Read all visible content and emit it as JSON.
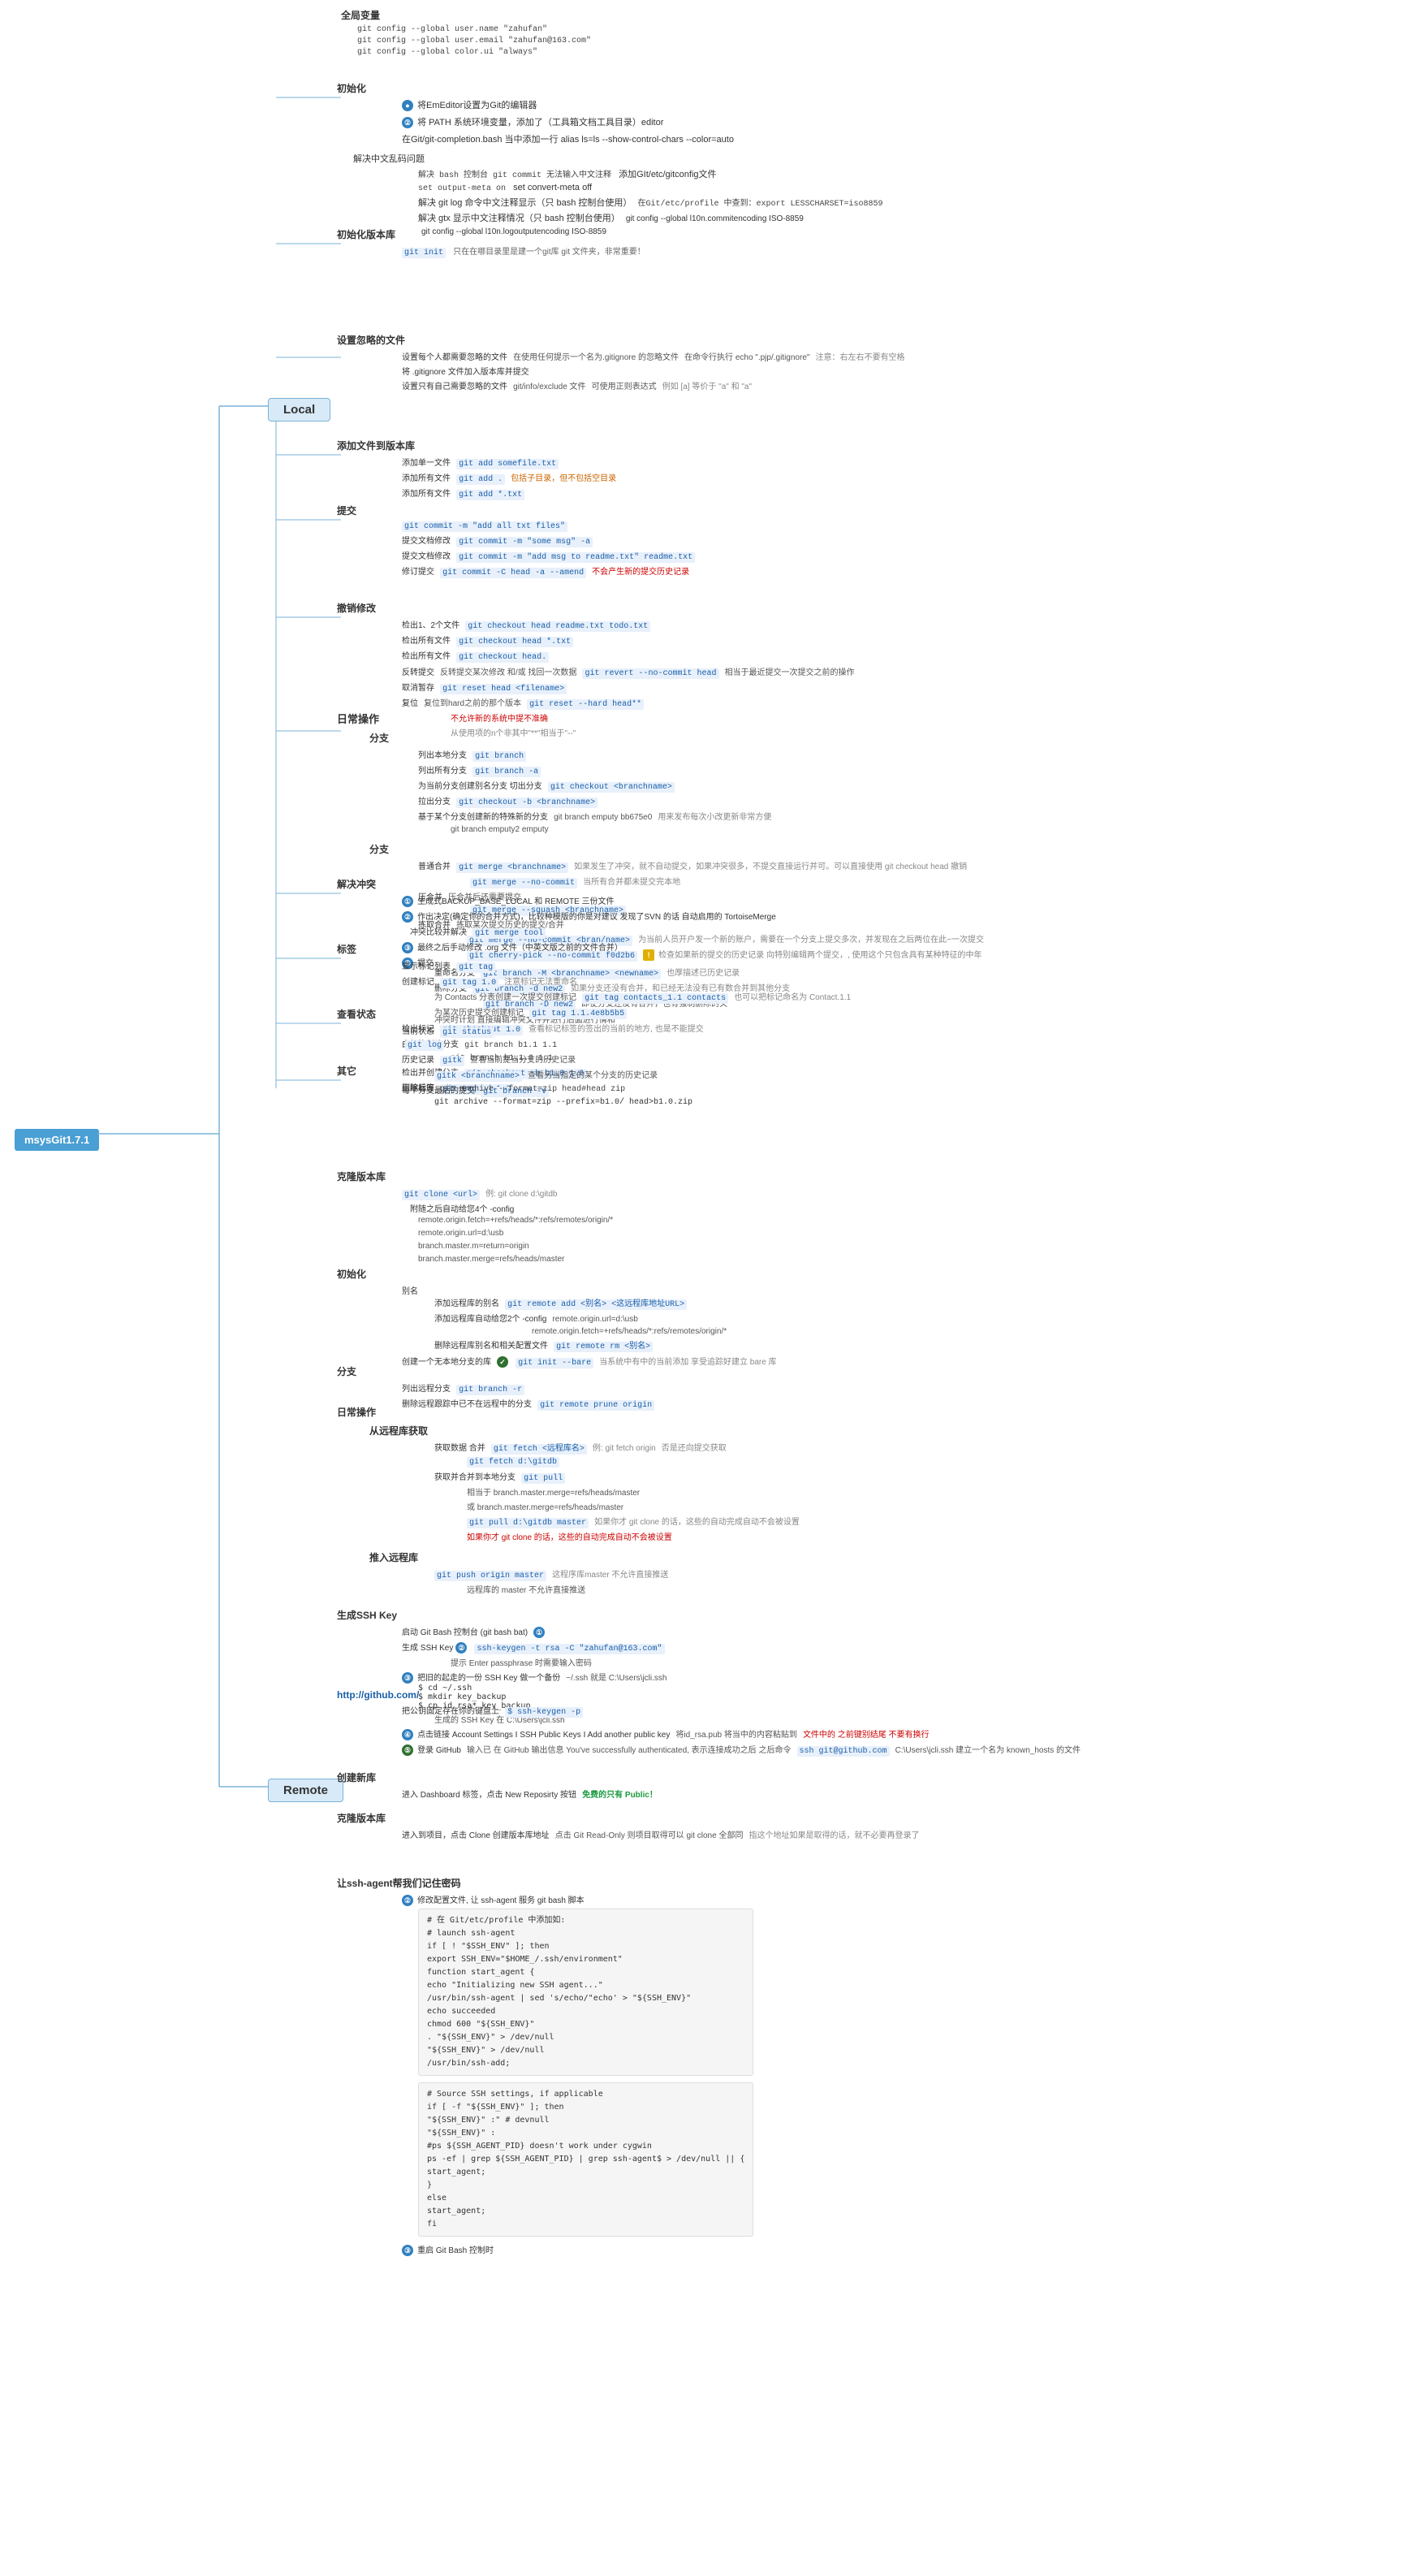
{
  "title": "msysGit1.7.1",
  "main_nodes": {
    "local": "Local",
    "remote": "Remote"
  },
  "local_sections": {
    "initialization": "初始化",
    "version_control_init": "初始化版本库",
    "configure_ignore": "设置忽略的文件",
    "add_files": "添加文件到版本库",
    "commit": "提交",
    "undo": "撤销修改",
    "branch": "分支",
    "daily_ops": "日常操作",
    "resolve_conflict": "解决冲突",
    "tags": "标签",
    "check_status": "查看状态",
    "other": "其它"
  },
  "remote_sections": {
    "clone": "克隆版本库",
    "init": "初始化",
    "branch": "分支",
    "daily_ops": "日常操作",
    "fetch_from_remote": "从远程库获取",
    "push_to_remote": "推入远程库",
    "generate_ssh": "生成SSH Key",
    "github": "http://github.com/",
    "create_new_repo": "创建新库",
    "clone_repo": "克隆版本库",
    "ssh_agent": "让ssh-agent帮我们记住密码"
  },
  "global_vars_label": "全局变量",
  "codes": {
    "user_name": "git config --global user.name \"zahufan\"",
    "user_email": "git config --global user.email \"zahufan@163.com\"",
    "color": "git config --global color.ui \"always\"",
    "editor_note": "将EmEditor设置为Git的编辑器",
    "editor_path": "将 PATH 系统环境变量，添加了（工具箱文档工具目录）editor",
    "completion": "在Git/git-completion.bash 当中添加一行 alias ls=ls --show-control-chars --color=auto",
    "commit_utf8": "解决 bash 控制台 git commit 无法输入中文注释",
    "gitconfig_utf8": "添加GIt/etc/gitconfig文件",
    "set_output_meta": "set output-meta on",
    "set_convert_meta": "set convert-meta off",
    "log_encoding": "解决 git log 命令中文注释显示（只 bash 控制台使用）",
    "in_gitconfig": "在Git/etc/profile 中查到：export LESSCHARSET=iso8859",
    "git_init": "git init",
    "git_init_note": "只在在哪目录里是建一个git库  git 文件夹，非常重要！",
    "branch_cmd": "git branch",
    "branch_all": "git branch -a",
    "checkout_branch": "git checkout <branchname>",
    "checkout_new": "git checkout -b <branchname>",
    "merge": "git merge <branchname>",
    "merge_no_commit": "git merge --no-commit",
    "merge_squash": "git merge --squash <branchname>",
    "merge_no_commit2": "git merge --no-commit <bran/name>",
    "cherry_pick": "git cherry-pick --no-commit f0d2b6",
    "branch_M": "git branch -M <branchname> <newname>",
    "branch_d_new2": "git branch -d new2",
    "branch_D_new2": "git branch -D new2",
    "merge_tool": "git merge tool",
    "status": "git status",
    "log": "git log",
    "gitk": "gitk",
    "gitk_branch": "gitk <branchname>",
    "branch_v": "git branch -v",
    "archive": "git archive --format=zip head#head zip",
    "archive_prefix": "git archive --format=zip --prefix=b1.0/ head>b1.0.zip",
    "git_add": "git add somefile.txt",
    "git_add_all": "git add .",
    "git_add_txt": "git add *.txt",
    "git_commit_m": "git commit -m \"add all txt files\"",
    "git_commit_some": "git commit -m \"some msg\" -a",
    "git_commit_readme": "git commit -m \"add msg to readme.txt\" readme.txt",
    "git_commit_amend": "git commit -C head -a --amend",
    "git_checkout_head": "git checkout head readme.txt todo.txt",
    "git_checkout_head_txt": "git checkout head *.txt",
    "git_checkout_head2": "git checkout head.",
    "git_revert": "git revert --no-commit head",
    "git_reset_head": "git reset head <filename>",
    "git_reset_hard": "git reset --hard head**",
    "git_tag": "git tag",
    "git_tag_v1": "git tag 1.0",
    "git_tag_contacts": "git tag contacts_1.1 contacts",
    "git_tag_sha": "git tag 1.1.4e8b5b5",
    "git_checkout_1": "git checkout 1.0",
    "git_checkout_b_010": "git checkout -b b1.0 1.0",
    "git_branch_b11": "git branch b1.1 1.1",
    "git_branch_b110": "git branch b1.1.0 1.1",
    "git_tag_d": "git tag -d 1.0",
    "git_clone": "git clone <url>",
    "git_clone_ex": "例: git clone d:\\gitdb",
    "git_remote_add": "git remote add <别名> <这远程库地址URL>",
    "git_remote_rm": "git remote rm <别名>",
    "git_init_bare": "git init --bare",
    "git_branch_r": "git branch -r",
    "git_remote_prune": "git remote prune origin",
    "git_fetch": "git fetch <远程库名>",
    "git_fetch_origin": "git fetch d:\\gitdb",
    "git_pull": "git pull",
    "git_pull_master": "git pull d:\\gitdb master",
    "git_push_origin": "git push origin master",
    "git_ssh_keygen": "ssh-keygen -t rsa -C \"zahufan@163.com\"",
    "git_ssh_test": "ssh git@github.com",
    "ssh_cd": "cd ~/.ssh",
    "ssh_mkdir": "mkdir key_backup",
    "ssh_cp": "cp id_rsa* key_backup",
    "ssh_path": "~/.ssh 就是 C:\\Users\\jcli.ssh"
  },
  "colors": {
    "accent_blue": "#4a9fd4",
    "branch_line": "#7ab3d8",
    "node_bg": "#e8f4fb",
    "code_bg": "#e8f0fb",
    "warn_yellow": "#e0b000",
    "highlight": "#3080c0"
  }
}
